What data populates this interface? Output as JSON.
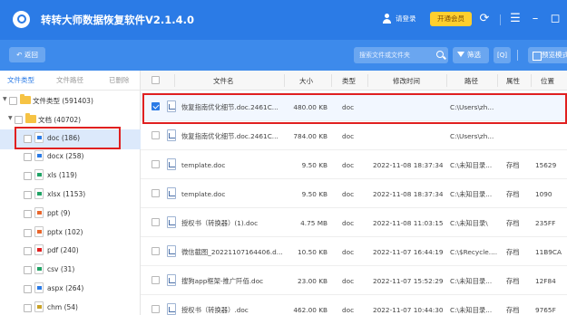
{
  "app": {
    "title": "转转大师数据恢复软件V2.1.4.0",
    "login_label": "请登录",
    "vip_label": "开通会员"
  },
  "titlebar_icons": [
    "refresh-icon",
    "menu-icon",
    "minimize-icon",
    "maximize-icon"
  ],
  "toolbar": {
    "back_label": "返回",
    "search_placeholder": "搜索文件或文件夹",
    "filter_label": "筛选",
    "scan_label": "[Q]",
    "preview_label": "预览模式"
  },
  "sidebar": {
    "tabs": [
      "文件类型",
      "文件路径",
      "已删除"
    ],
    "tree": [
      {
        "label": "文件类型 (591403)",
        "kind": "folder",
        "level": 0
      },
      {
        "label": "文档 (40702)",
        "kind": "folder",
        "level": 1
      },
      {
        "label": "doc (186)",
        "kind": "doc",
        "level": 2,
        "selected": true
      },
      {
        "label": "docx (258)",
        "kind": "doc",
        "level": 2
      },
      {
        "label": "xls (119)",
        "kind": "xls",
        "level": 2
      },
      {
        "label": "xlsx (1153)",
        "kind": "xls",
        "level": 2
      },
      {
        "label": "ppt (9)",
        "kind": "ppt",
        "level": 2
      },
      {
        "label": "pptx (102)",
        "kind": "ppt",
        "level": 2
      },
      {
        "label": "pdf (240)",
        "kind": "pdf",
        "level": 2
      },
      {
        "label": "csv (31)",
        "kind": "xls",
        "level": 2
      },
      {
        "label": "aspx (264)",
        "kind": "web",
        "level": 2
      },
      {
        "label": "chm (54)",
        "kind": "chm",
        "level": 2
      }
    ]
  },
  "table": {
    "headers": [
      "文件名",
      "大小",
      "类型",
      "修改时间",
      "路径",
      "属性",
      "位置"
    ],
    "rows": [
      {
        "name": "恢复指南优化细节.doc.2461C...",
        "size": "480.00 KB",
        "type": "doc",
        "time": "",
        "path": "C:\\Users\\zh...",
        "attr": "",
        "pos": "",
        "checked": true
      },
      {
        "name": "恢复指南优化细节.doc.2461C...",
        "size": "784.00 KB",
        "type": "doc",
        "time": "",
        "path": "C:\\Users\\zh...",
        "attr": "",
        "pos": "",
        "checked": false
      },
      {
        "name": "template.doc",
        "size": "9.50 KB",
        "type": "doc",
        "time": "2022-11-08 18:37:34",
        "path": "C:\\未知目录...",
        "attr": "存档",
        "pos": "15629",
        "checked": false
      },
      {
        "name": "template.doc",
        "size": "9.50 KB",
        "type": "doc",
        "time": "2022-11-08 18:37:34",
        "path": "C:\\未知目录...",
        "attr": "存档",
        "pos": "1090",
        "checked": false
      },
      {
        "name": "授权书（转换器）(1).doc",
        "size": "4.75 MB",
        "type": "doc",
        "time": "2022-11-08 11:03:15",
        "path": "C:\\未知目录\\",
        "attr": "存档",
        "pos": "235FF",
        "checked": false
      },
      {
        "name": "微信截图_20221107164406.d...",
        "size": "10.50 KB",
        "type": "doc",
        "time": "2022-11-07 16:44:19",
        "path": "C:\\$Recycle....",
        "attr": "存档",
        "pos": "11B9CA",
        "checked": false
      },
      {
        "name": "搜狗app框架-推广阡佰.doc",
        "size": "23.00 KB",
        "type": "doc",
        "time": "2022-11-07 15:52:29",
        "path": "C:\\未知目录...",
        "attr": "存档",
        "pos": "12F84",
        "checked": false
      },
      {
        "name": "授权书（转换器）.doc",
        "size": "462.00 KB",
        "type": "doc",
        "time": "2022-11-07 10:44:30",
        "path": "C:\\未知目录...",
        "attr": "存档",
        "pos": "9765F",
        "checked": false
      }
    ]
  }
}
